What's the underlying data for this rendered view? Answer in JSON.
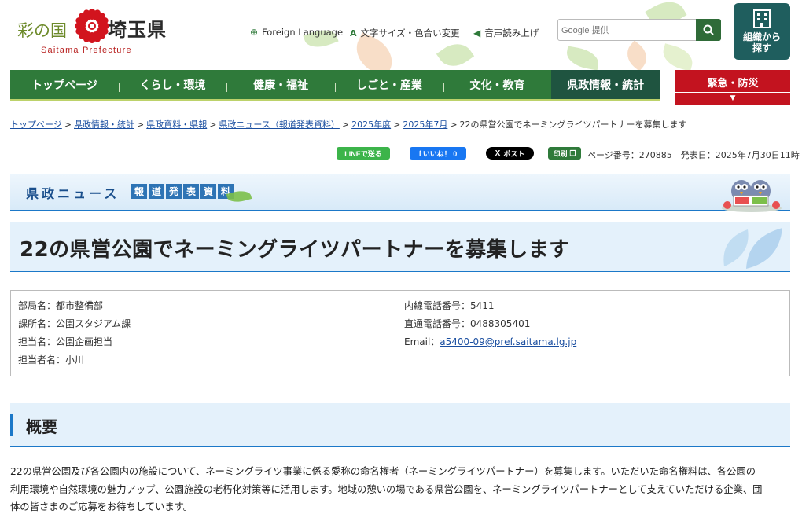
{
  "header": {
    "logo_jp_left": "彩の国",
    "logo_jp_right": "埼玉県",
    "logo_en": "Saitama Prefecture",
    "foreign_language": "Foreign Language",
    "text_size_color": "文字サイズ・色合い変更",
    "read_aloud": "音声読み上げ",
    "search_placeholder": "Google 提供",
    "org_search": "組織から探す"
  },
  "nav": {
    "items": [
      "トップページ",
      "くらし・環境",
      "健康・福祉",
      "しごと・産業",
      "文化・教育",
      "県政情報・統計"
    ],
    "emergency": "緊急・防災",
    "emergency_arrow": "▼"
  },
  "breadcrumb": {
    "links": [
      "トップページ",
      "県政情報・統計",
      "県政資料・県報",
      "県政ニュース（報道発表資料）",
      "2025年度",
      "2025年7月"
    ],
    "current": "22の県営公園でネーミングライツパートナーを募集します"
  },
  "share": {
    "line": "LINEで送る",
    "like": "いいね！ 0",
    "post": "ポスト",
    "print": "印刷",
    "page_number": "ページ番号：270885",
    "published": "発表日：2025年7月30日11時"
  },
  "banner": {
    "title": "県政ニュース",
    "tag_chars": [
      "報",
      "道",
      "発",
      "表",
      "資",
      "料"
    ]
  },
  "page_title": "22の県営公園でネーミングライツパートナーを募集します",
  "contact": {
    "department": "部局名：都市整備部",
    "section": "課所名：公園スタジアム課",
    "unit": "担当名：公園企画担当",
    "person": "担当者名：小川",
    "extension": "内線電話番号：5411",
    "direct": "直通電話番号：0488305401",
    "email_label": "Email：",
    "email": "a5400-09@pref.saitama.lg.jp"
  },
  "outline": {
    "heading": "概要",
    "line1": "22の県営公園及び各公園内の施設について、ネーミングライツ事業に係る愛称の命名権者（ネーミングライツパートナー）を募集します。いただいた命名権料は、各公園の",
    "line2": "利用環境や自然環境の魅力アップ、公園施設の老朽化対策等に活用します。地域の憩いの場である県営公園を、ネーミングライツパートナーとして支えていただける企業、団",
    "line3": "体の皆さまのご応募をお待ちしています。"
  },
  "colors": {
    "nav_green": "#2f7a3a",
    "nav_active": "#1f5440",
    "emergency_red": "#c3131f",
    "accent_blue": "#1b78c8",
    "org_button": "#1f5e5e"
  }
}
